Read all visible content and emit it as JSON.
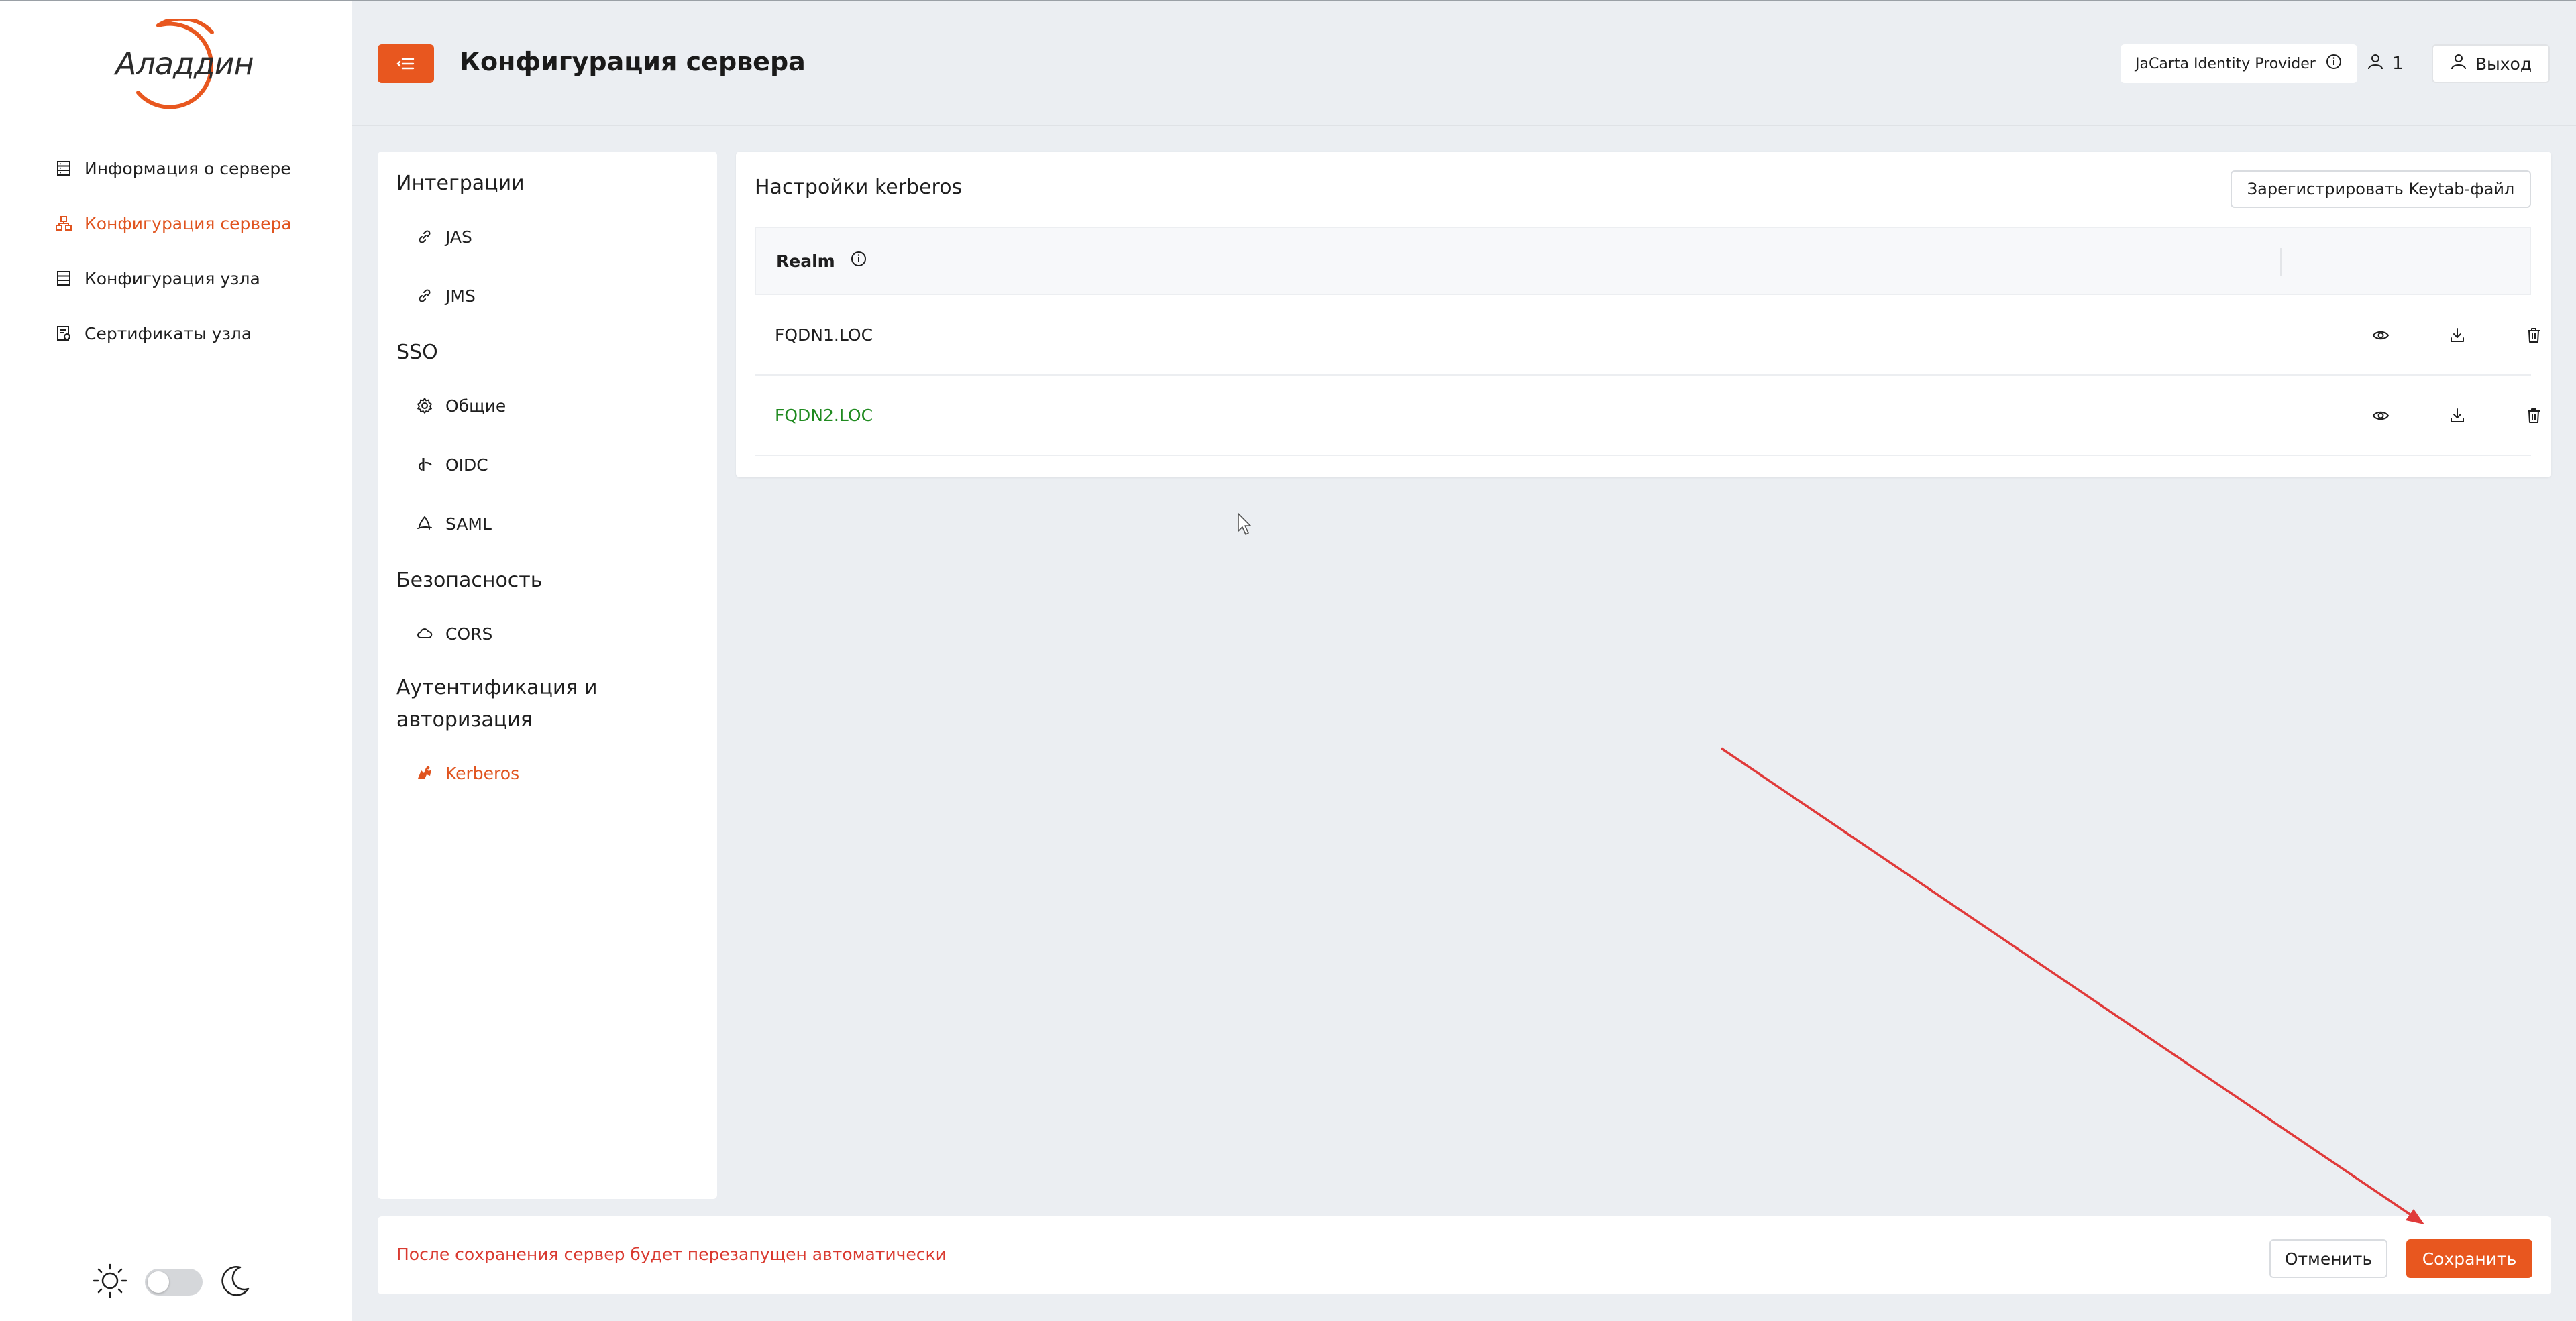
{
  "brand": {
    "logo_text": "Аладдин",
    "accent": "#e8571f"
  },
  "sidebar": {
    "items": [
      {
        "label": "Информация о сервере",
        "icon": "server-list-icon",
        "active": false
      },
      {
        "label": "Конфигурация сервера",
        "icon": "network-icon",
        "active": true
      },
      {
        "label": "Конфигурация узла",
        "icon": "server-list-icon",
        "active": false
      },
      {
        "label": "Сертификаты узла",
        "icon": "certificate-icon",
        "active": false
      }
    ],
    "theme": {
      "light_icon": "sun-icon",
      "dark_icon": "moon-icon",
      "dark_enabled": false
    }
  },
  "header": {
    "title": "Конфигурация сервера",
    "provider": "JaCarta Identity Provider",
    "user_count": "1",
    "logout_label": "Выход"
  },
  "subnav": {
    "sections": [
      {
        "title": "Интеграции",
        "items": [
          "JAS",
          "JMS"
        ]
      },
      {
        "title": "SSO",
        "items": [
          "Общие",
          "OIDC",
          "SAML"
        ]
      },
      {
        "title": "Безопасность",
        "items": [
          "CORS"
        ]
      },
      {
        "title_line1": "Аутентификация и",
        "title_line2": "авторизация",
        "items": [
          "Kerberos"
        ]
      }
    ],
    "active_item": "Kerberos"
  },
  "kerberos": {
    "title": "Настройки kerberos",
    "register_button": "Зарегистрировать Keytab-файл",
    "table": {
      "column": "Realm",
      "rows": [
        {
          "realm": "FQDN1.LOC",
          "highlight": false
        },
        {
          "realm": "FQDN2.LOC",
          "highlight": true
        }
      ]
    }
  },
  "footer": {
    "message": "После сохранения сервер будет перезапущен автоматически",
    "cancel_label": "Отменить",
    "save_label": "Сохранить"
  }
}
